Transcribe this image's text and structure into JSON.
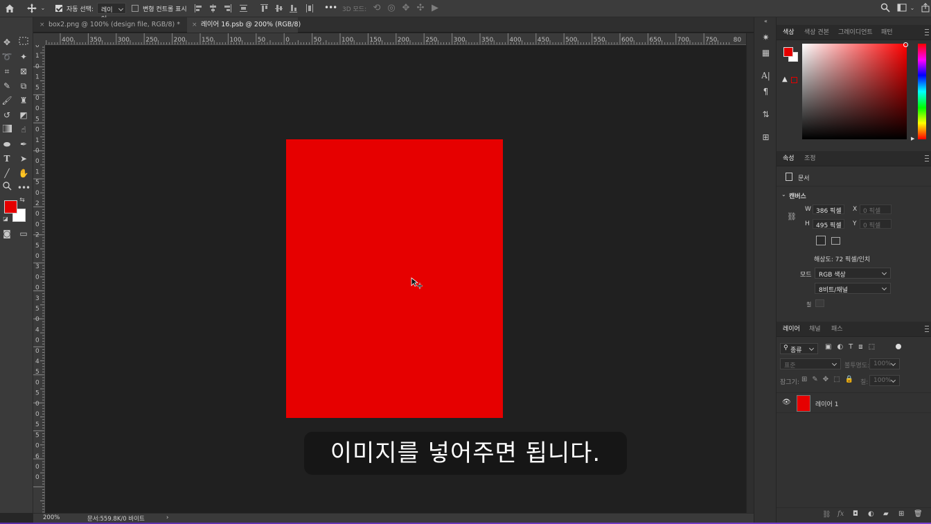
{
  "options_bar": {
    "auto_select_label": "자동 선택:",
    "auto_select_checked": true,
    "auto_select_target": "레이어",
    "show_transform_label": "변형 컨트롤 표시",
    "show_transform_checked": false,
    "more_label": "•••",
    "mode_3d_label": "3D 모드:"
  },
  "tabs": [
    {
      "label": "box2.png @ 100% (design file, RGB/8) *",
      "active": false
    },
    {
      "label": "레이어 16.psb @ 200% (RGB/8)",
      "active": true
    }
  ],
  "ruler_top": [
    "400",
    "350",
    "300",
    "250",
    "200",
    "150",
    "100",
    "50",
    "0",
    "50",
    "100",
    "150",
    "200",
    "250",
    "300",
    "350",
    "400",
    "450",
    "500",
    "550",
    "600",
    "650",
    "700",
    "750",
    "80"
  ],
  "ruler_left": [
    "0",
    "1",
    "0",
    "1",
    "5",
    "0",
    "0",
    "5",
    "0",
    "1",
    "0",
    "0",
    "1",
    "5",
    "0",
    "2",
    "0",
    "0",
    "2",
    "5",
    "0",
    "3",
    "0",
    "0",
    "3",
    "5",
    "0",
    "4",
    "0",
    "0",
    "4",
    "5",
    "0",
    "5",
    "0",
    "0",
    "5",
    "5",
    "0",
    "6",
    "0",
    "0"
  ],
  "document": {
    "fill_color": "#e60000"
  },
  "subtitle": "이미지를 넣어주면 됩니다.",
  "status": {
    "zoom": "200%",
    "doc_info": "문서:559.8K/0 바이트",
    "arrow": "›"
  },
  "colors": {
    "foreground": "#e60000",
    "background": "#ffffff"
  },
  "color_panel": {
    "tabs": [
      "색상",
      "색상 견본",
      "그레이디언트",
      "패턴"
    ],
    "active_tab": "색상"
  },
  "properties_panel": {
    "tabs": [
      "속성",
      "조정"
    ],
    "document_label": "문서",
    "canvas_section": "캔버스",
    "width_label": "W",
    "width_value": "386 픽셀",
    "height_label": "H",
    "height_value": "495 픽셀",
    "x_label": "X",
    "x_value": "0 픽셀",
    "y_label": "Y",
    "y_value": "0 픽셀",
    "resolution": "해상도: 72 픽셀/인치",
    "mode_label": "모드",
    "mode_value": "RGB 색상",
    "bit_depth": "8비트/채널",
    "fill_label": "칠"
  },
  "layers_panel": {
    "tabs": [
      "레이어",
      "채널",
      "패스"
    ],
    "filter_label": "종류",
    "blend_mode": "표준",
    "opacity_label": "불투명도:",
    "opacity_value": "100%",
    "lock_label": "잠그기:",
    "fill_label": "칠:",
    "fill_value": "100%",
    "layers": [
      {
        "name": "레이어 1",
        "visible": true,
        "thumb_color": "#e60000"
      }
    ]
  }
}
